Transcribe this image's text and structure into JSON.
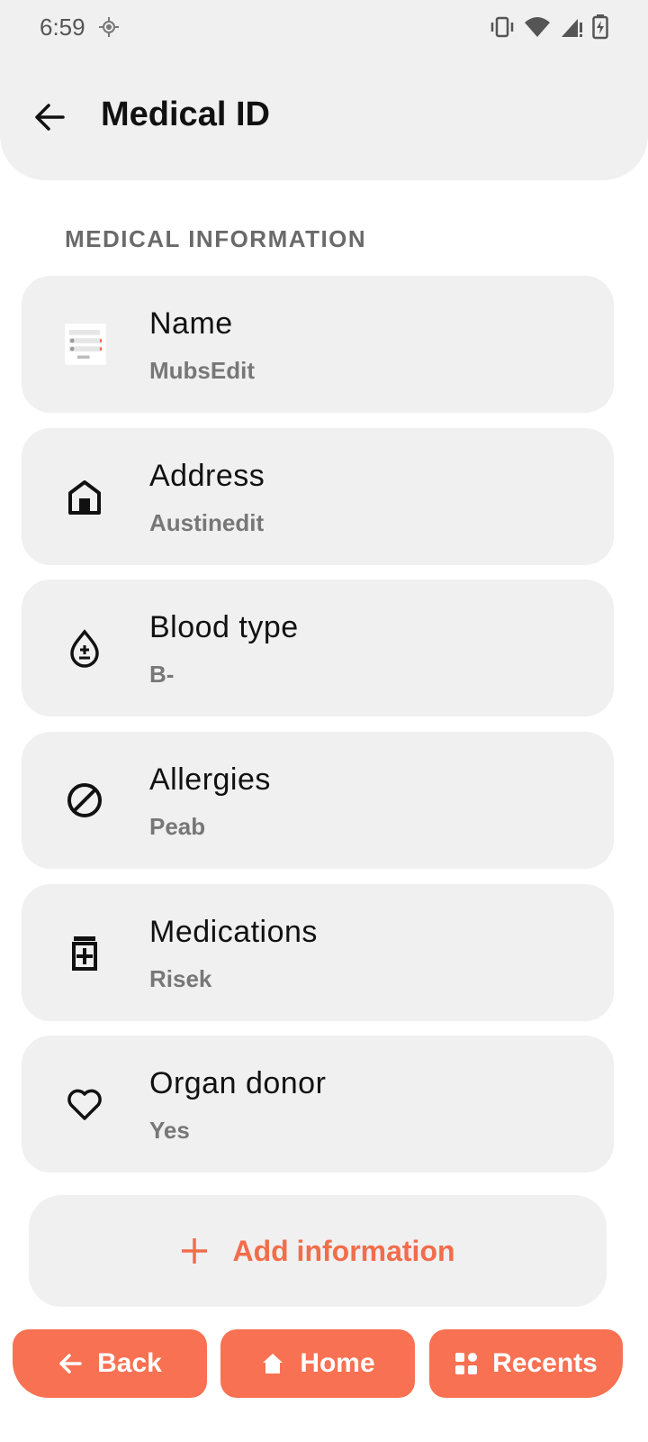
{
  "status": {
    "time": "6:59"
  },
  "header": {
    "title": "Medical ID"
  },
  "section": {
    "label": "MEDICAL INFORMATION"
  },
  "items": [
    {
      "label": "Name",
      "value": "MubsEdit",
      "icon": "avatar-thumbnail"
    },
    {
      "label": "Address",
      "value": "Austinedit",
      "icon": "home-icon"
    },
    {
      "label": "Blood type",
      "value": "B-",
      "icon": "blood-drop-icon"
    },
    {
      "label": "Allergies",
      "value": "Peab",
      "icon": "block-icon"
    },
    {
      "label": "Medications",
      "value": "Risek",
      "icon": "medication-icon"
    },
    {
      "label": "Organ donor",
      "value": "Yes",
      "icon": "heart-icon"
    }
  ],
  "add": {
    "label": "Add information"
  },
  "nav": {
    "back": "Back",
    "home": "Home",
    "recents": "Recents"
  },
  "colors": {
    "accent": "#f77152",
    "accent_text": "#f26d4b",
    "card": "#f0f0f0"
  }
}
